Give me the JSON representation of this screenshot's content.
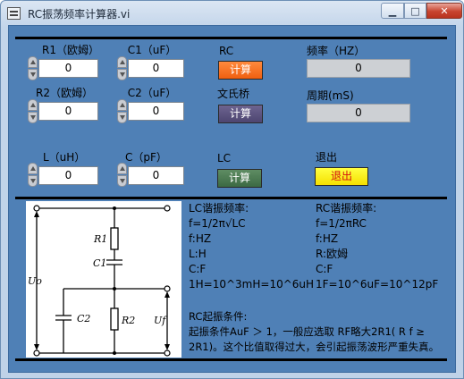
{
  "window": {
    "title": "RC振荡频率计算器.vi",
    "min_glyph": "▁",
    "max_glyph": "□",
    "close_glyph": "✕"
  },
  "rc_section": {
    "r1_label": "R1（欧姆）",
    "r1_value": "0",
    "c1_label": "C1（uF）",
    "c1_value": "0",
    "r2_label": "R2（欧姆）",
    "r2_value": "0",
    "c2_label": "C2（uF）",
    "c2_value": "0",
    "rc_label": "RC",
    "rc_button": "计算",
    "wien_label": "文氏桥",
    "wien_button": "计算"
  },
  "outputs": {
    "freq_label": "频率（HZ）",
    "freq_value": "0",
    "period_label": "周期(mS)",
    "period_value": "0"
  },
  "lc_section": {
    "l_label": "L（uH）",
    "l_value": "0",
    "c_label": "C（pF）",
    "c_value": "0",
    "lc_label": "LC",
    "lc_button": "计算"
  },
  "exit": {
    "label": "退出",
    "button": "退出"
  },
  "info": {
    "lc_title": "LC谐振频率:",
    "lc_lines": [
      "f=1/2π√LC",
      "f:HZ",
      "L:H",
      "C:F",
      "1H=10^3mH=10^6uH"
    ],
    "rc_title": "RC谐振频率:",
    "rc_lines": [
      "f=1/2πRC",
      "f:HZ",
      "R:欧姆",
      "C:F",
      "1F=10^6uF=10^12pF"
    ],
    "cond_title": "RC起振条件:",
    "cond_line1": "起振条件AuF ＞ 1，一般应选取 RF略大2R1( R f ≥",
    "cond_line2": "2R1)。这个比值取得过大，会引起振荡波形严重失真。"
  },
  "circuit": {
    "r1": "R1",
    "c1": "C1",
    "r2": "R2",
    "c2": "C2",
    "uo": "Uo",
    "uf": "Uf"
  }
}
